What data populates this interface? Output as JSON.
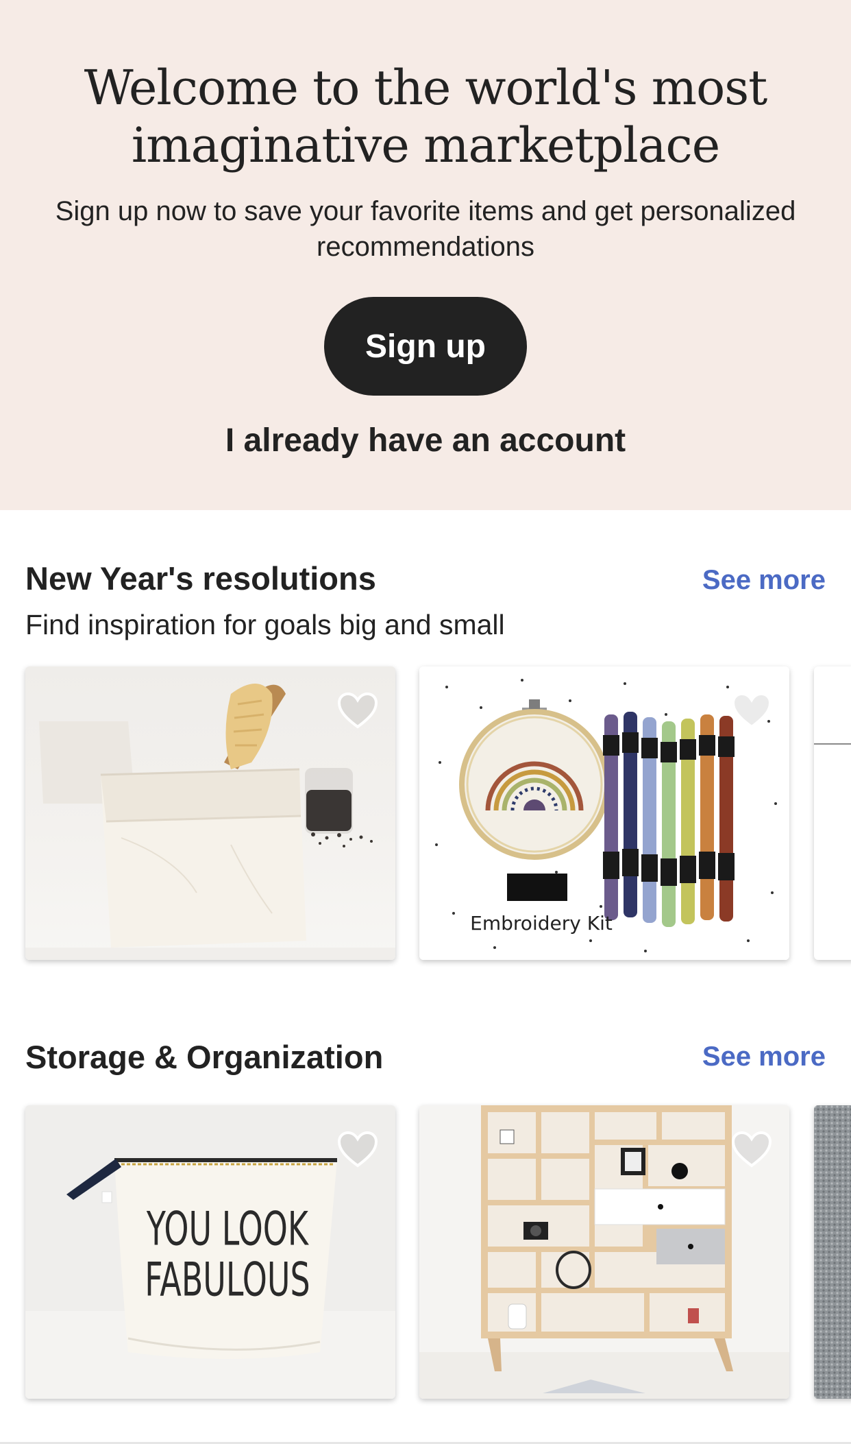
{
  "hero": {
    "title_line1": "Welcome to the world's most",
    "title_line2": "imaginative marketplace",
    "subtitle": "Sign up now to save your favorite items and get personalized recommendations",
    "signup_label": "Sign up",
    "login_label": "I already have an account"
  },
  "sections": [
    {
      "title": "New Year's resolutions",
      "see_more": "See more",
      "description": "Find inspiration for goals big and small",
      "cards": [
        {
          "image": "paper-storage-basket-with-brush",
          "favorite_icon": "heart-outline-icon"
        },
        {
          "image": "embroidery-kit-with-threads",
          "caption": "Embroidery Kit",
          "favorite_icon": "heart-outline-icon"
        }
      ]
    },
    {
      "title": "Storage & Organization",
      "see_more": "See more",
      "cards": [
        {
          "image": "canvas-pouch-you-look-fabulous",
          "text_line1": "YOU LOOK",
          "text_line2": "FABULOUS",
          "favorite_icon": "heart-outline-icon"
        },
        {
          "image": "wooden-wall-shelf-unit",
          "favorite_icon": "heart-outline-icon"
        }
      ]
    }
  ],
  "colors": {
    "hero_bg": "#f6ebe6",
    "button_bg": "#222222",
    "link_blue": "#4b6ac4",
    "text": "#222222"
  }
}
